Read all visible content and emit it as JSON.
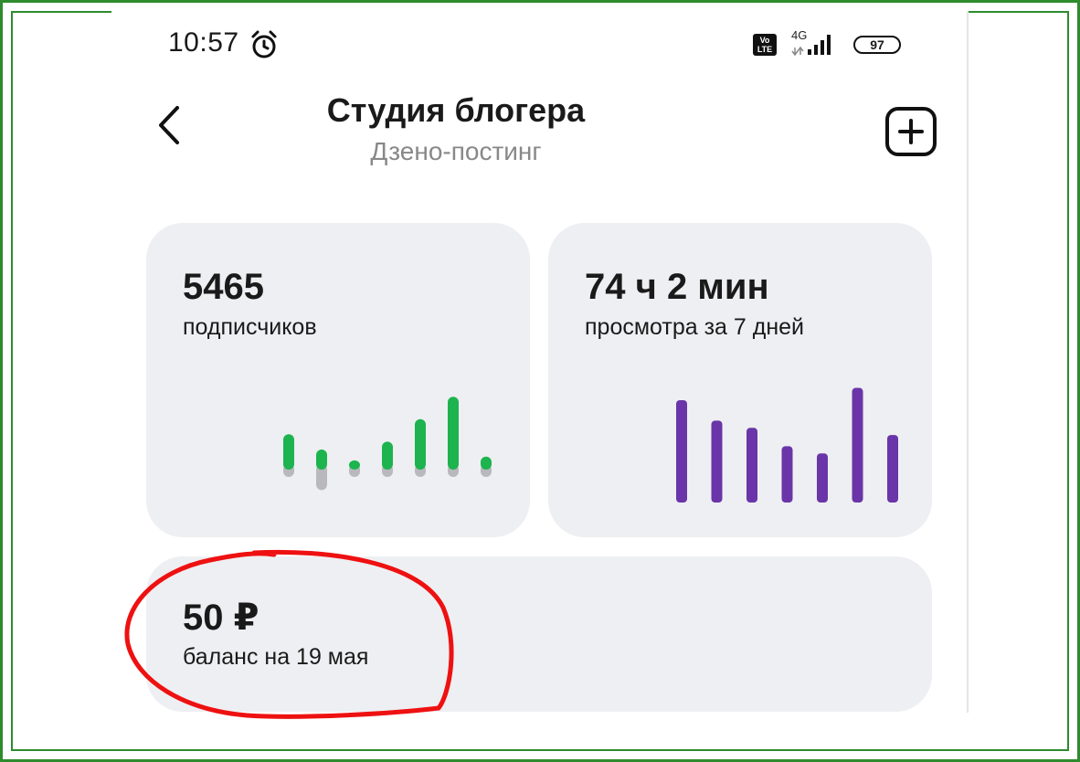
{
  "status_bar": {
    "time": "10:57",
    "network_badge": "Vo LTE",
    "network_type": "4G",
    "battery": "97",
    "icons": [
      "alarm-icon",
      "volte-icon",
      "signal-icon",
      "battery-icon"
    ]
  },
  "header": {
    "title": "Студия блогера",
    "subtitle": "Дзено-постинг",
    "back_icon": "chevron-left-icon",
    "add_icon": "plus-square-icon"
  },
  "cards": {
    "subscribers": {
      "value": "5465",
      "label": "подписчиков"
    },
    "views": {
      "value": "74 ч 2 мин",
      "label": "просмотра за 7 дней"
    },
    "balance": {
      "value": "50 ₽",
      "label": "баланс на 19 мая"
    }
  },
  "chart_data": [
    {
      "type": "bar",
      "series": [
        {
          "values": [
            4,
            -2,
            0.5,
            3,
            6,
            9,
            1
          ],
          "color": "#1db34f"
        }
      ],
      "negative_color": "#b9b9bd"
    },
    {
      "type": "bar",
      "series": [
        {
          "values": [
            100,
            80,
            73,
            55,
            48,
            112,
            66
          ],
          "color": "#6a35a8"
        }
      ]
    }
  ],
  "colors": {
    "accent_green": "#1db34f",
    "accent_purple": "#6a35a8",
    "card_bg": "#eeeff2",
    "annotation_red": "#ee1111",
    "frame_green": "#2e8b2e"
  }
}
